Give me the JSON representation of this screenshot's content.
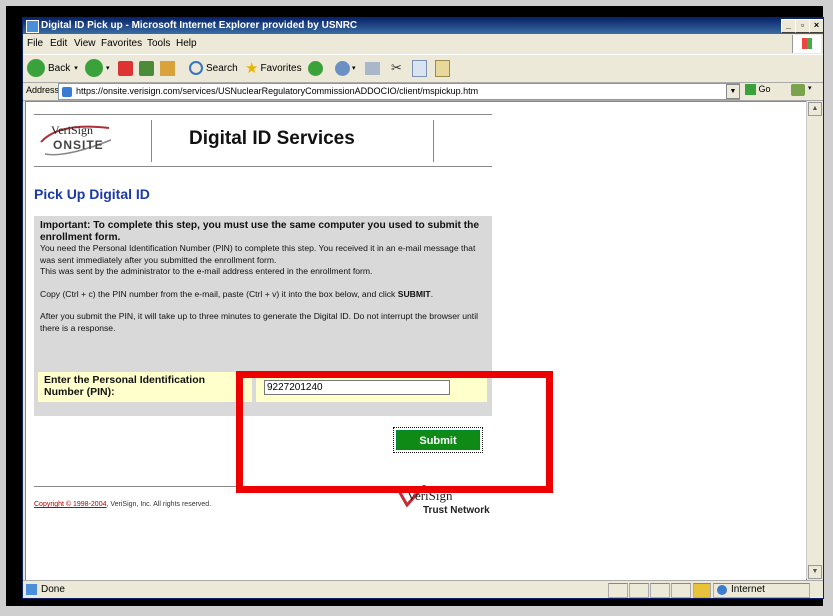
{
  "window": {
    "title": "Digital ID Pick up - Microsoft Internet Explorer provided by USNRC",
    "controls": [
      "_",
      "ƀ",
      "x"
    ]
  },
  "menu": [
    "File",
    "Edit",
    "View",
    "Favorites",
    "Tools",
    "Help"
  ],
  "toolbar": {
    "back_label": "Back",
    "search_label": "Search",
    "favorites_label": "Favorites"
  },
  "address": {
    "label": "Address",
    "url": "https://onsite.verisign.com/services/USNuclearRegulatoryCommissionADDOCIO/client/mspickup.htm",
    "go_label": "Go"
  },
  "page": {
    "logo_top": "VeriSign",
    "logo_bottom": "ONSITE",
    "header_title": "Digital ID Services",
    "section_title": "Pick Up Digital ID",
    "important": "Important: To complete this step, you must use the same computer you used to submit the enrollment form.",
    "para1": "You need the Personal Identification Number (PIN) to complete this step. You received it in an e-mail message that was sent immediately after you submitted the enrollment form.",
    "para2": "This was sent by the administrator to the e-mail address entered in the enrollment form.",
    "para3_pre": "Copy (Ctrl + c) the PIN number from the e-mail, paste (Ctrl + v) it into the box below, and click ",
    "para3_bold": "SUBMIT",
    "para3_post": ".",
    "para4": "After you submit the PIN, it will take up to three minutes to generate the Digital ID. Do not interrupt the browser until there is a response.",
    "pin_label": "Enter the Personal Identification Number (PIN):",
    "pin_value": "9227201240",
    "submit_label": "Submit",
    "copyright_link": "Copyright © 1998-2004",
    "copyright_rest": ", VeriSign, Inc. All rights reserved.",
    "footer_logo": "VeriSign",
    "footer_logo_sub": "Trust Network"
  },
  "status": {
    "text": "Done",
    "zone": "Internet"
  }
}
